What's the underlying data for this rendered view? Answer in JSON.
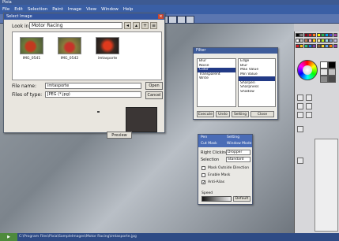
{
  "window": {
    "title": "Pixia"
  },
  "menu": [
    "File",
    "Edit",
    "Selection",
    "Paint",
    "Image",
    "View",
    "Window",
    "Help"
  ],
  "open_dialog": {
    "title": "Select Image",
    "look_in_label": "Look in:",
    "look_in_value": "Motor Racing",
    "files": [
      {
        "name": "IMG_0541"
      },
      {
        "name": "IMG_0542"
      },
      {
        "name": "imtasporte"
      }
    ],
    "file_name_label": "File name:",
    "file_name_value": "imtasporte",
    "file_type_label": "Files of type:",
    "file_type_value": "JPEG (*.jpg)",
    "open_label": "Open",
    "cancel_label": "Cancel",
    "preview_label": "Preview"
  },
  "filters_dialog": {
    "title": "Filter",
    "categories": [
      "Blur",
      "Noise",
      "Color",
      "Transparent",
      "Write"
    ],
    "selected_category": 2,
    "items": [
      "Edge",
      "Blur",
      "Max Value",
      "Min Value",
      "",
      "Sharpen",
      "Sharpness",
      "Shadow"
    ],
    "selected_item": 4,
    "buttons": [
      "Execute",
      "Undo",
      "Setting",
      "Close"
    ]
  },
  "brush_dialog": {
    "tabs": [
      "Pen",
      "Setting",
      "Cut Mask",
      "Window Mode"
    ],
    "right_clicking_label": "Right Clicking",
    "right_clicking_value": "Dropper",
    "selection_label": "Selection",
    "selection_value": "Standard",
    "checkboxes": [
      {
        "label": "Mask Outside Direction",
        "checked": false
      },
      {
        "label": "Enable Mask",
        "checked": false
      },
      {
        "label": "Anti-Alias",
        "checked": true
      }
    ],
    "speed_label": "Speed",
    "default_label": "Default"
  },
  "palette_colors": [
    "#000000",
    "#7f7f7f",
    "#880015",
    "#ed1c24",
    "#ff7f27",
    "#fff200",
    "#22b14c",
    "#00a2e8",
    "#3f48cc",
    "#a349a4",
    "#ffffff",
    "#c3c3c3",
    "#b97a57",
    "#ffaec9",
    "#ffc90e",
    "#efe4b0",
    "#b5e61d",
    "#99d9ea",
    "#7092be",
    "#c8bfe7",
    "#e01b24",
    "#f5c211",
    "#2ec27e",
    "#1c71d8",
    "#813d9c",
    "#865e3c",
    "#f6d32d",
    "#62a0ea",
    "#ff7800",
    "#9141ac"
  ],
  "status_text": "C:\\Program Files\\Pixia\\SampleImages\\Motor Racing\\imtasporte.jpg"
}
